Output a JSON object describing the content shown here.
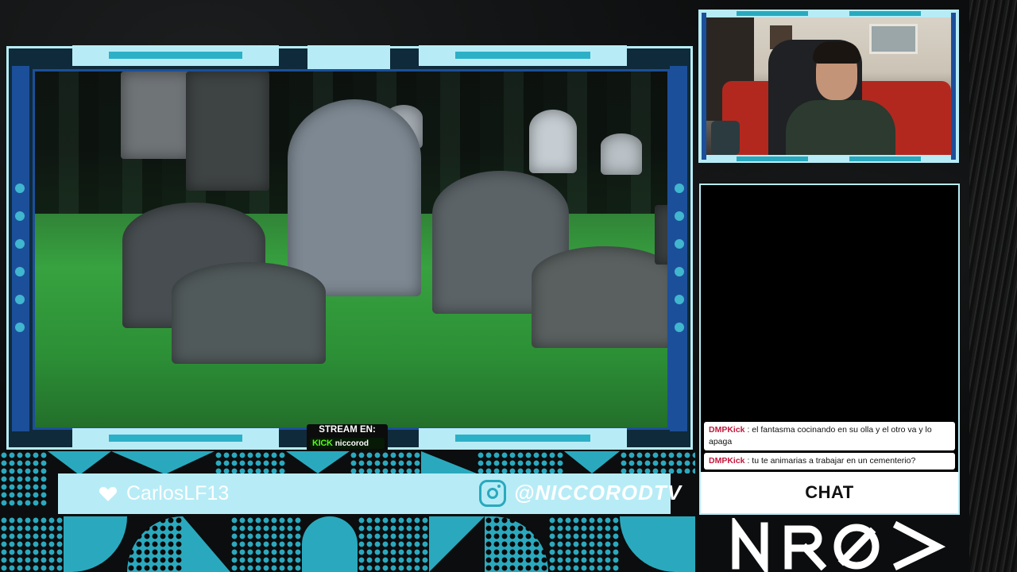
{
  "stream_badge": {
    "label": "STREAM EN:",
    "platform": "KICK",
    "channel": "niccorod"
  },
  "name_bar": {
    "username": "CarlosLF13",
    "instagram_handle": "@NICCORODTV"
  },
  "chat": {
    "messages": [
      {
        "author": "DMPKick",
        "text": ": el fantasma cocinando en su olla y el otro va y lo apaga"
      },
      {
        "author": "DMPKick",
        "text": ": tu te animarias a trabajar en un cementerio?"
      }
    ],
    "title": "CHAT"
  },
  "colors": {
    "frame": "#b7ecf6",
    "accent": "#2aa9be",
    "deep": "#1c4f9a",
    "kick": "#53fc18"
  },
  "icons": [
    "heart-icon",
    "instagram-icon",
    "kick-logo",
    "channel-logo"
  ]
}
